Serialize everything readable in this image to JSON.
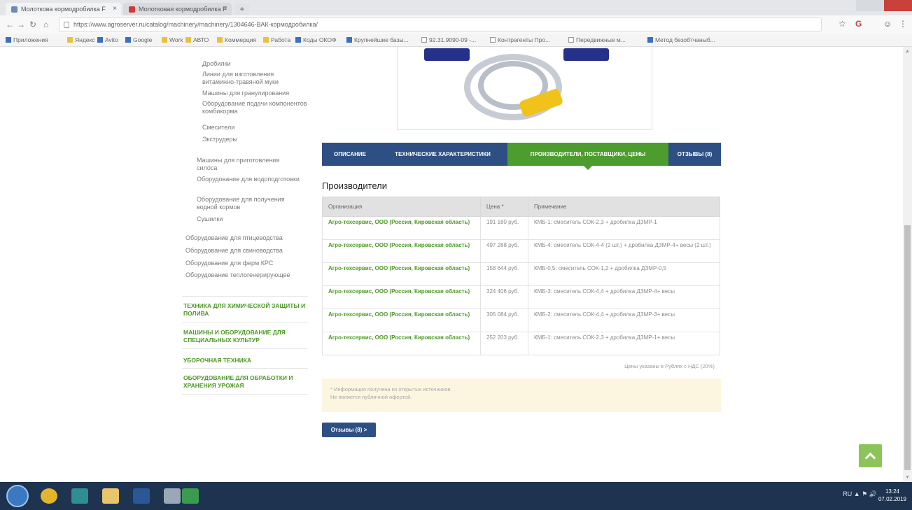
{
  "browser": {
    "tabs": [
      {
        "label": "Молоткова кормодробилка F"
      },
      {
        "label": "Молотковая кормодробилка F"
      }
    ],
    "new_tab_label": "+",
    "url": "https://www.agroserver.ru/catalog/machinery/machinery/1304646-ВАК-кормодробилка/",
    "bookmarks": [
      "Приложения",
      "Яндекс",
      "Avito",
      "Google",
      "Work",
      "АВТО",
      "Коммерция",
      "Работа",
      "Коды ОКОФ",
      "Крупнейшие базы...",
      "92.31.9090-09 -...",
      "Контрагенты Про...",
      "Передвижные м...",
      "Метод безобтчаныб..."
    ]
  },
  "sidebar": {
    "subitems": [
      {
        "label": "Дробилки"
      },
      {
        "label": "Линии для изготовления витаминно-травяной муки"
      },
      {
        "label": "Машины для гранулирования"
      },
      {
        "label": "Оборудование подачи компонентов комбикорма"
      },
      {
        "label": "Смесители"
      },
      {
        "label": "Экструдеры"
      }
    ],
    "items": [
      {
        "label": "Машины для приготовления силоса"
      },
      {
        "label": "Оборудование для водоподготовки"
      },
      {
        "label": "Оборудование для получения водной кормов"
      },
      {
        "label": "Сушилки"
      }
    ],
    "groups": [
      {
        "label": "Оборудование для птицеводства"
      },
      {
        "label": "Оборудование для свиноводства"
      },
      {
        "label": "Оборудование для ферм КРС"
      },
      {
        "label": "Оборудование теплогенерирующее"
      }
    ],
    "categories": [
      {
        "label": "ТЕХНИКА ДЛЯ ХИМИЧЕСКОЙ ЗАЩИТЫ И ПОЛИВА"
      },
      {
        "label": "МАШИНЫ И ОБОРУДОВАНИЕ ДЛЯ СПЕЦИАЛЬНЫХ КУЛЬТУР"
      },
      {
        "label": "УБОРОЧНАЯ ТЕХНИКА"
      },
      {
        "label": "ОБОРУДОВАНИЕ ДЛЯ ОБРАБОТКИ И ХРАНЕНИЯ УРОЖАЯ"
      }
    ]
  },
  "product_tabs": [
    {
      "label": "Описание"
    },
    {
      "label": "Технические характеристики"
    },
    {
      "label": "Производители, поставщики, цены"
    },
    {
      "label": "Отзывы (8)"
    }
  ],
  "section_title": "Производители",
  "table": {
    "headers": [
      "Организация",
      "Цена *",
      "Примечание"
    ],
    "rows": [
      {
        "org": "Агро-техсервис, ООО (Россия, Кировская область)",
        "price": "191 180 руб.",
        "note": "КМБ-1: смеситель СОК-2,3 + дробилка ДЗМР-1"
      },
      {
        "org": "Агро-техсервис, ООО (Россия, Кировская область)",
        "price": "497 288 руб.",
        "note": "КМБ-4: смеситель СОК-4-4 (2 шт.) + дробилка ДЗМР-4+ весы (2 шт.)"
      },
      {
        "org": "Агро-техсервис, ООО (Россия, Кировская область)",
        "price": "158 644 руб.",
        "note": "КМБ-0,5: смеситель СОК-1,2 + дробилка ДЗМР-0,5"
      },
      {
        "org": "Агро-техсервис, ООО (Россия, Кировская область)",
        "price": "324 406 руб.",
        "note": "КМБ-3: смеситель СОК-4,4 + дробилка ДЗМР-4+ весы"
      },
      {
        "org": "Агро-техсервис, ООО (Россия, Кировская область)",
        "price": "305 084 руб.",
        "note": "КМБ-2: смеситель СОК-4,4 + дробилка ДЗМР-3+ весы"
      },
      {
        "org": "Агро-техсервис, ООО (Россия, Кировская область)",
        "price": "252 203 руб.",
        "note": "КМБ-1: смеситель СОК-2,3 + дробилка ДЗМР-1+ весы"
      }
    ]
  },
  "prices_note": "Цены указаны в Рублях с НДС (20%)",
  "info": {
    "line1": "* Информация получена из открытых источников.",
    "line2": "Не является публичной офертой."
  },
  "reviews_button": "Отзывы (8) >",
  "taskbar": {
    "tray_text": "RU ▲ ⚑ 🔊",
    "time": "13:24",
    "date": "07.02.2019"
  },
  "colors": {
    "accent_blue": "#2e4f84",
    "accent_green": "#4c9c2e",
    "link_green": "#4e9a26",
    "info_bg": "#fcf6e1"
  }
}
